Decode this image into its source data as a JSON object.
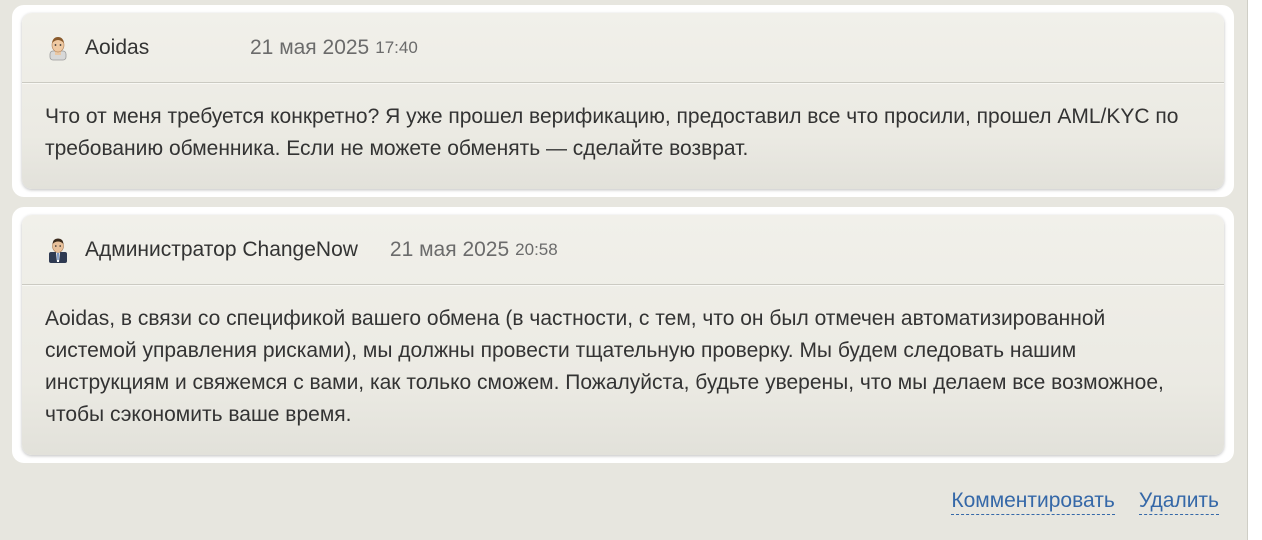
{
  "comments": [
    {
      "author": "Aoidas",
      "avatar_icon": "user-avatar-icon",
      "date": "21 мая 2025",
      "time": "17:40",
      "text": "Что от меня требуется конкретно? Я уже прошел верификацию, предоставил все что просили, прошел AML/KYC по требованию обменника. Если не можете обменять — сделайте возврат."
    },
    {
      "author": "Администратор ChangeNow",
      "avatar_icon": "admin-avatar-icon",
      "date": "21 мая 2025",
      "time": "20:58",
      "text": "Aoidas, в связи со спецификой вашего обмена (в частности, с тем, что он был отмечен автоматизированной системой управления рисками), мы должны провести тщательную проверку. Мы будем следовать нашим инструкциям и свяжемся с вами, как только сможем. Пожалуйста, будьте уверены, что мы делаем все возможное, чтобы сэкономить ваше время."
    }
  ],
  "actions": {
    "comment_label": "Комментировать",
    "delete_label": "Удалить"
  },
  "colors": {
    "link": "#3568a8",
    "panel_bg": "#e7e6df",
    "card_bg": "#ebeae3"
  }
}
